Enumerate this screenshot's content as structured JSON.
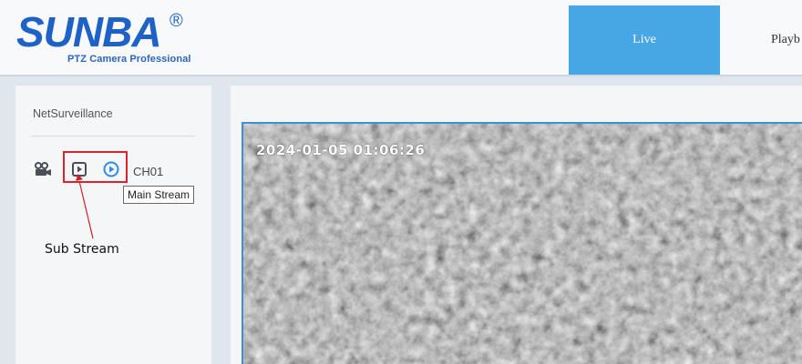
{
  "logo": {
    "brand": "SUNBA",
    "registered": "®",
    "tagline": "PTZ Camera Professional",
    "brand_color": "#1f62c7"
  },
  "nav": {
    "tabs": [
      {
        "label": "Live",
        "active": true
      },
      {
        "label": "Playb",
        "active": false
      }
    ],
    "active_color": "#46a7e4"
  },
  "sidebar": {
    "title": "NetSurveillance",
    "channel": {
      "label": "CH01",
      "icons": [
        "camera-icon",
        "sub-stream-icon",
        "main-stream-icon"
      ]
    },
    "tooltip": "Main Stream",
    "annotation": "Sub Stream",
    "highlight_color": "#e0202a"
  },
  "video": {
    "timestamp": "2024-01-05 01:06:26"
  }
}
